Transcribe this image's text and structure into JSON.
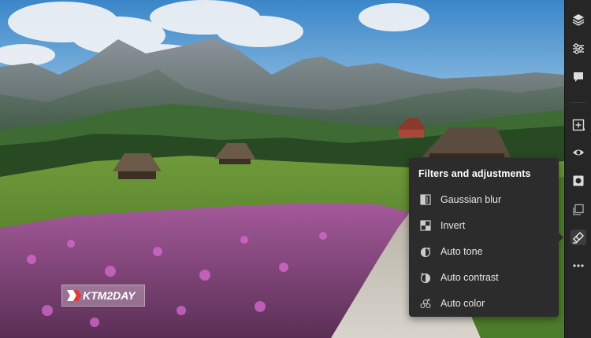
{
  "popover": {
    "title": "Filters and adjustments",
    "items": [
      {
        "label": "Gaussian blur",
        "icon": "gaussian-blur-icon"
      },
      {
        "label": "Invert",
        "icon": "invert-icon"
      },
      {
        "label": "Auto tone",
        "icon": "auto-tone-icon"
      },
      {
        "label": "Auto contrast",
        "icon": "auto-contrast-icon"
      },
      {
        "label": "Auto color",
        "icon": "auto-color-icon"
      }
    ]
  },
  "toolbar": {
    "tools": [
      {
        "name": "layers",
        "icon": "layers-icon"
      },
      {
        "name": "adjustments",
        "icon": "sliders-icon"
      },
      {
        "name": "comments",
        "icon": "comment-icon"
      },
      {
        "name": "add-layer",
        "icon": "add-layer-icon"
      },
      {
        "name": "visibility",
        "icon": "eye-icon"
      },
      {
        "name": "mask",
        "icon": "mask-icon"
      },
      {
        "name": "transform",
        "icon": "transform-icon"
      },
      {
        "name": "filters",
        "icon": "filters-icon"
      },
      {
        "name": "more",
        "icon": "more-icon"
      }
    ]
  },
  "watermark": {
    "text": "KTM2DAY"
  },
  "colors": {
    "toolbar_bg": "#262626",
    "popover_bg": "#2c2c2c",
    "text_primary": "#ffffff",
    "text_secondary": "#e6e6e6"
  }
}
